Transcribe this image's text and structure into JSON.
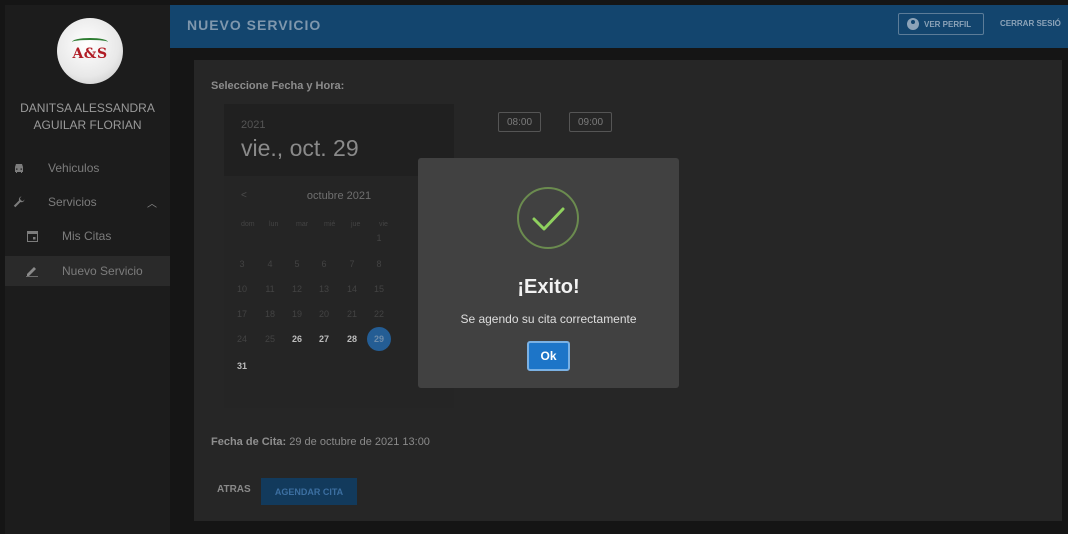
{
  "app": {
    "logo_text": "A&S"
  },
  "sidebar": {
    "user_name_line1": "DANITSA ALESSANDRA",
    "user_name_line2": "AGUILAR FLORIAN",
    "items": [
      {
        "label": "Vehiculos",
        "icon": "car-icon"
      },
      {
        "label": "Servicios",
        "icon": "wrench-icon"
      },
      {
        "label": "Mis Citas",
        "icon": "calendar-icon"
      },
      {
        "label": "Nuevo Servicio",
        "icon": "pencil-icon"
      }
    ]
  },
  "header": {
    "title": "NUEVO SERVICIO",
    "profile_label": "VER PERFIL",
    "logout_label": "CERRAR SESIÓ"
  },
  "main": {
    "select_label": "Seleccione Fecha y Hora:",
    "times": [
      "08:00",
      "09:00"
    ],
    "fecha_label": "Fecha de Cita:",
    "fecha_value": "29 de octubre de 2021 13:00",
    "back_label": "ATRAS",
    "submit_label": "AGENDAR CITA"
  },
  "datepicker": {
    "year": "2021",
    "date": "vie., oct. 29",
    "month": "octubre 2021",
    "prev": "<",
    "weekdays": [
      "dom",
      "lun",
      "mar",
      "mié",
      "jue",
      "vie"
    ],
    "days": [
      "1",
      "3",
      "4",
      "5",
      "6",
      "7",
      "8",
      "10",
      "11",
      "12",
      "13",
      "14",
      "15",
      "17",
      "18",
      "19",
      "20",
      "21",
      "22",
      "24",
      "25",
      "26",
      "27",
      "28",
      "29",
      "31"
    ]
  },
  "modal": {
    "title": "¡Exito!",
    "message": "Se agendo su cita correctamente",
    "ok_label": "Ok"
  },
  "colors": {
    "header_bg": "#13456e",
    "accent": "#1d75c8",
    "success": "#7fbf4f"
  }
}
